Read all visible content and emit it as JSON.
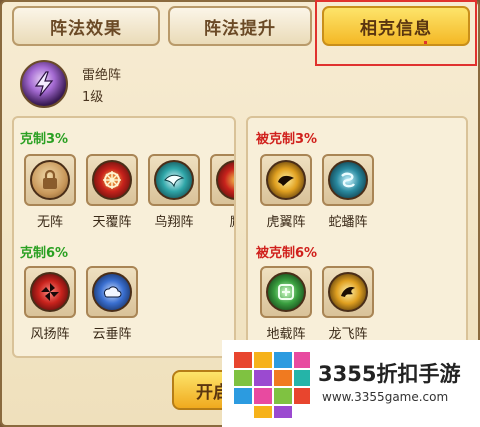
{
  "tabs": [
    {
      "label": "阵法效果",
      "active": false
    },
    {
      "label": "阵法提升",
      "active": false
    },
    {
      "label": "相克信息",
      "active": true
    }
  ],
  "formation": {
    "name": "雷绝阵",
    "level": "1级",
    "icon": "lightning-emblem-icon"
  },
  "counters": {
    "section1": {
      "title": "克制3%",
      "items": [
        {
          "label": "无阵",
          "icon": "lock-icon",
          "color": "#c8975a"
        },
        {
          "label": "天覆阵",
          "icon": "wheel-emblem-icon",
          "color": "#c8221c"
        },
        {
          "label": "鸟翔阵",
          "icon": "bird-emblem-icon",
          "color": "#2fa6a8"
        },
        {
          "label": "鷹",
          "icon": "partial-emblem-icon",
          "color": "#c8221c"
        }
      ]
    },
    "section2": {
      "title": "克制6%",
      "items": [
        {
          "label": "风扬阵",
          "icon": "pinwheel-emblem-icon",
          "color": "#c8221c"
        },
        {
          "label": "云垂阵",
          "icon": "cloud-emblem-icon",
          "color": "#3a6fd0"
        }
      ]
    }
  },
  "countered_by": {
    "section1": {
      "title": "被克制3%",
      "items": [
        {
          "label": "虎翼阵",
          "icon": "tiger-emblem-icon",
          "color": "#e0a020"
        },
        {
          "label": "蛇蟠阵",
          "icon": "snake-emblem-icon",
          "color": "#2a8aa0"
        }
      ]
    },
    "section2": {
      "title": "被克制6%",
      "items": [
        {
          "label": "地载阵",
          "icon": "earth-emblem-icon",
          "color": "#3aa040"
        },
        {
          "label": "龙飞阵",
          "icon": "dragon-emblem-icon",
          "color": "#e0a020"
        }
      ]
    }
  },
  "open_button": {
    "label": "开启"
  },
  "watermark": {
    "title": "3355折扣手游",
    "url": "www.3355game.com"
  }
}
